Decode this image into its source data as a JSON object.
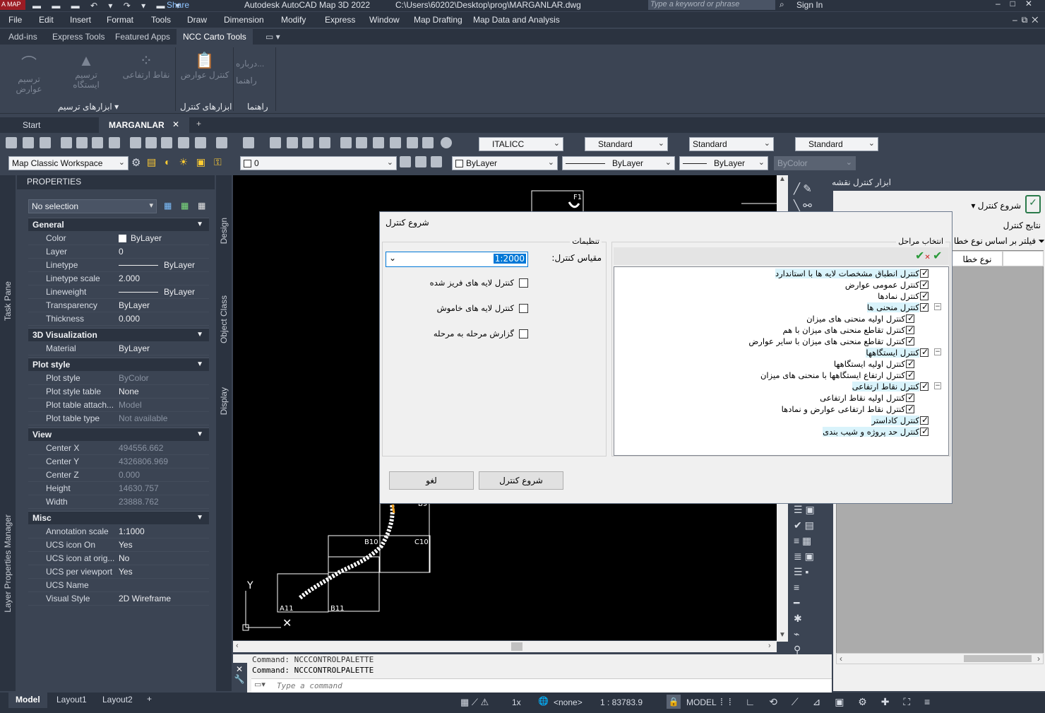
{
  "title": {
    "app_title": "Autodesk AutoCAD Map 3D 2022",
    "path": "C:\\Users\\60202\\Desktop\\prog\\MARGANLAR.dwg",
    "search_placeholder": "Type a keyword or phrase",
    "sign_in": "Sign In",
    "share": "Share",
    "logo": "A MAP"
  },
  "menu": [
    "File",
    "Edit",
    "Insert",
    "Format",
    "Tools",
    "Draw",
    "Dimension",
    "Modify",
    "Express",
    "Window",
    "Map Drafting",
    "Map Data and Analysis"
  ],
  "ribbon_tabs": [
    "Add-ins",
    "Express Tools",
    "Featured Apps",
    "NCC Carto Tools"
  ],
  "ribbon": {
    "btn_features": "ترسیم عوارض",
    "btn_station": "ترسیم ایستگاه",
    "btn_points": "نقاط ارتفاعی",
    "btn_control": "کنترل عوارض",
    "about": "درباره...",
    "help": "راهنما",
    "panel_draw": "ابزارهای ترسیم",
    "panel_control": "ابزارهای کنترل",
    "panel_help": "راهنما"
  },
  "doc_tabs": {
    "start": "Start",
    "active": "MARGANLAR"
  },
  "toolbar": {
    "text_style": "ITALICC",
    "dim_style": "Standard",
    "table_style": "Standard",
    "mleader_style": "Standard",
    "workspace": "Map Classic Workspace",
    "layer": "0",
    "color": "ByLayer",
    "linetype": "ByLayer",
    "lineweight": "ByLayer",
    "plotstyle": "ByColor"
  },
  "left_strip": {
    "task_pane": "Task Pane",
    "layer_manager": "Layer Properties Manager"
  },
  "side_tabs": {
    "design": "Design",
    "object_class": "Object Class",
    "display": "Display"
  },
  "properties": {
    "header": "PROPERTIES",
    "selection": "No selection",
    "general": "General",
    "color_k": "Color",
    "color_v": "ByLayer",
    "layer_k": "Layer",
    "layer_v": "0",
    "linetype_k": "Linetype",
    "linetype_v": "ByLayer",
    "ltscale_k": "Linetype scale",
    "ltscale_v": "2.000",
    "lweight_k": "Lineweight",
    "lweight_v": "ByLayer",
    "transp_k": "Transparency",
    "transp_v": "ByLayer",
    "thick_k": "Thickness",
    "thick_v": "0.000",
    "viz3d": "3D Visualization",
    "material_k": "Material",
    "material_v": "ByLayer",
    "plotstyle": "Plot style",
    "ps_k": "Plot style",
    "ps_v": "ByColor",
    "pst_k": "Plot style table",
    "pst_v": "None",
    "pta_k": "Plot table attach...",
    "pta_v": "Model",
    "ptt_k": "Plot table type",
    "ptt_v": "Not available",
    "view": "View",
    "cx_k": "Center X",
    "cx_v": "494556.662",
    "cy_k": "Center Y",
    "cy_v": "4326806.969",
    "cz_k": "Center Z",
    "cz_v": "0.000",
    "h_k": "Height",
    "h_v": "14630.757",
    "w_k": "Width",
    "w_v": "23888.762",
    "misc": "Misc",
    "as_k": "Annotation scale",
    "as_v": "1:1000",
    "ucs_on_k": "UCS icon On",
    "ucs_on_v": "Yes",
    "ucs_orig_k": "UCS icon at orig...",
    "ucs_orig_v": "No",
    "ucs_vp_k": "UCS per viewport",
    "ucs_vp_v": "Yes",
    "ucs_name_k": "UCS Name",
    "ucs_name_v": "",
    "vs_k": "Visual Style",
    "vs_v": "2D Wireframe"
  },
  "canvas": {
    "labels": [
      "F1",
      "B9",
      "B10",
      "C10",
      "A11",
      "B11"
    ],
    "axis_y": "Y"
  },
  "command": {
    "line1": "Command: NCCCONTROLPALETTE",
    "line2": "Command: NCCCONTROLPALETTE",
    "placeholder": "Type a command"
  },
  "right_panel": {
    "title": "ابزار کنترل نقشه",
    "start_btn": "شروع کنترل",
    "results": "نتایج کنترل",
    "filter": "فیلتر بر اساس نوع خطا",
    "col_error_type": "نوع خطا"
  },
  "dialog": {
    "title": "شروع کنترل",
    "settings_group": "تنظیمات",
    "scale_label": "مقیاس کنترل:",
    "scale_value": "1:2000",
    "opt_frozen": "کنترل لایه های فریز شده",
    "opt_off": "کنترل لایه های خاموش",
    "opt_report": "گزارش مرحله به مرحله",
    "steps_group": "انتخاب مراحل",
    "steps": [
      {
        "label": "کنترل انطباق مشخصات لایه ها با استاندارد",
        "level": 0,
        "hl": true
      },
      {
        "label": "کنترل عمومی عوارض",
        "level": 0,
        "hl": false
      },
      {
        "label": "کنترل نمادها",
        "level": 0,
        "hl": false
      },
      {
        "label": "کنترل منحنی ها",
        "level": 0,
        "hl": true
      },
      {
        "label": "کنترل اولیه منحنی های میزان",
        "level": 1,
        "hl": false
      },
      {
        "label": "کنترل تقاطع منحنی های میزان با هم",
        "level": 1,
        "hl": false
      },
      {
        "label": "کنترل تقاطع منحنی های میزان با سایر عوارض",
        "level": 1,
        "hl": false
      },
      {
        "label": "کنترل ایستگاهها",
        "level": 0,
        "hl": true
      },
      {
        "label": "کنترل اولیه ایستگاهها",
        "level": 1,
        "hl": false
      },
      {
        "label": "کنترل ارتفاع ایستگاهها با منحنی های میزان",
        "level": 1,
        "hl": false
      },
      {
        "label": "کنترل نقاط ارتفاعی",
        "level": 0,
        "hl": true
      },
      {
        "label": "کنترل اولیه نقاط ارتفاعی",
        "level": 1,
        "hl": false
      },
      {
        "label": "کنترل نقاط ارتفاعی عوارض و نمادها",
        "level": 1,
        "hl": false
      },
      {
        "label": "کنترل کاداستر",
        "level": 0,
        "hl": true
      },
      {
        "label": "کنترل حد پروژه و شیب بندی",
        "level": 0,
        "hl": true
      }
    ],
    "cancel": "لغو",
    "start": "شروع کنترل"
  },
  "status": {
    "tab_model": "Model",
    "tab_l1": "Layout1",
    "tab_l2": "Layout2",
    "scale_1x": "1x",
    "coord": "<none>",
    "vp_scale": "1 : 83783.9",
    "model": "MODEL"
  }
}
